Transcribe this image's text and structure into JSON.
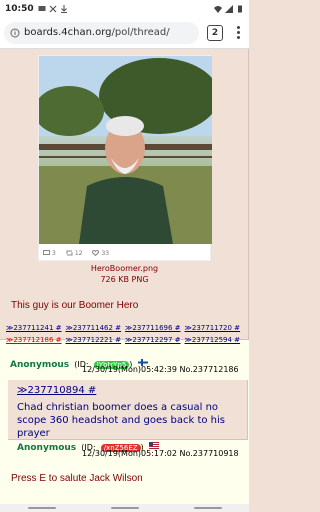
{
  "status": {
    "time": "10:50"
  },
  "browser": {
    "url_host": "boards.4chan.org",
    "url_path": "/pol/thread/",
    "tab_count": "2"
  },
  "post_op": {
    "tweet_counts": {
      "replies": "3",
      "retweets": "12",
      "likes": "33"
    },
    "file_name": "HeroBoomer.png",
    "file_size": "726 KB PNG",
    "comment": "This guy is our Boomer Hero",
    "reply_links": [
      "≫237711241 #",
      "≫237711462 #",
      "≫237711696 #",
      "≫237711720 #",
      "≫237712186 #",
      "≫237712221 #",
      "≫237712297 #",
      "≫237712594 #"
    ]
  },
  "reply1": {
    "name": "Anonymous",
    "id_prefix": "(ID:",
    "id": "JYbtrYp5",
    "id_suffix": ")",
    "datetime": "12/30/19(Mon)05:42:39",
    "post_no": "No.237712186",
    "quote": "≫237710894 #",
    "text": "Chad christian boomer does a casual no scope 360 headshot and goes back to his prayer"
  },
  "reply2": {
    "name": "Anonymous",
    "id_prefix": "(ID:",
    "id": "/xnZ56EZ",
    "id_suffix": ")",
    "datetime": "12/30/19(Mon)05:17:02",
    "post_no": "No.237710918",
    "text": "Press E to salute Jack Wilson"
  },
  "colors": {
    "page_bg": "#f0e0d6",
    "name_green": "#117743",
    "link_blue": "#000080",
    "text_maroon": "#800000",
    "id_green": "#2ecc40",
    "id_red": "#e0312f"
  }
}
